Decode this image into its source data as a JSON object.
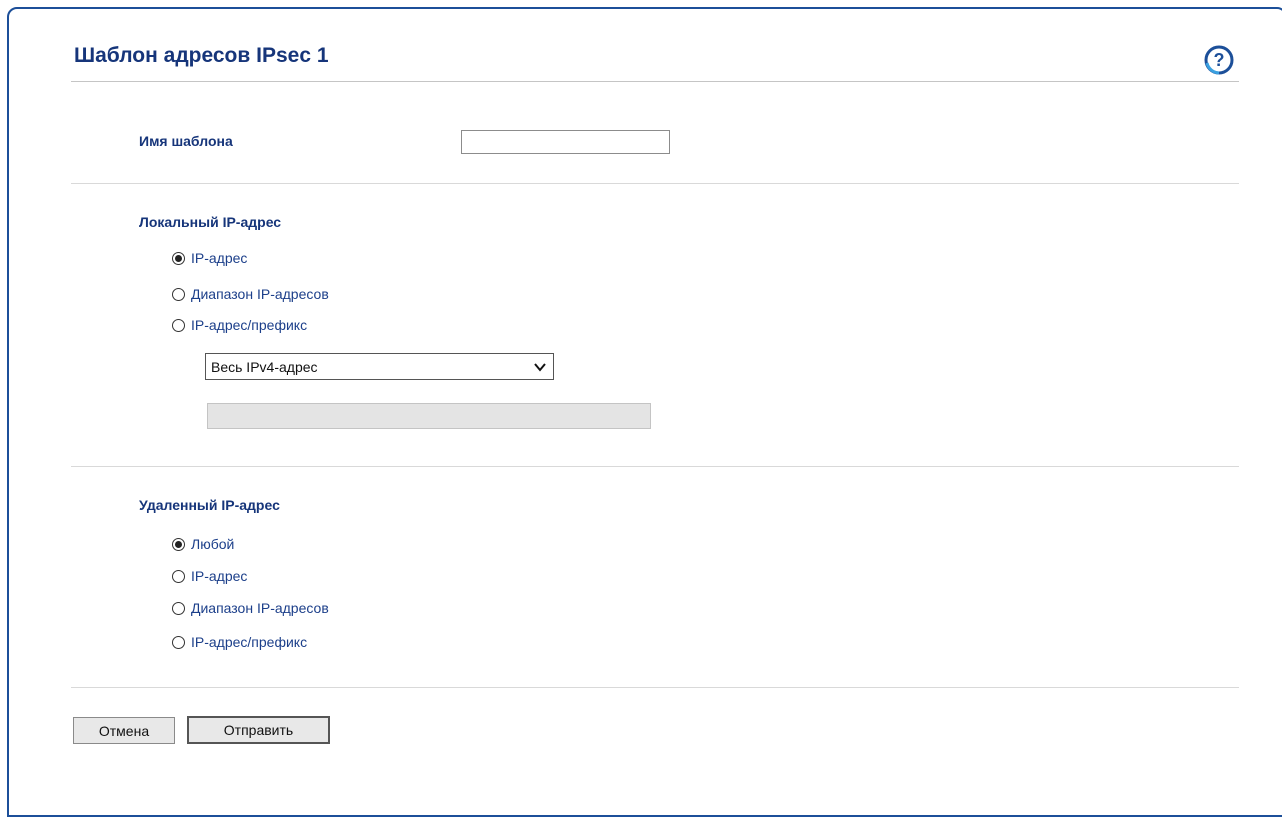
{
  "page": {
    "title": "Шаблон адресов IPsec 1",
    "help_icon": "help-question-icon"
  },
  "template_name": {
    "label": "Имя шаблона",
    "value": ""
  },
  "local_ip": {
    "heading": "Локальный IP-адрес",
    "options": [
      {
        "label": "IP-адрес",
        "checked": true
      },
      {
        "label": "Диапазон IP-адресов",
        "checked": false
      },
      {
        "label": "IP-адрес/префикс",
        "checked": false
      }
    ],
    "select_value": "Весь IPv4-адрес",
    "address_value": ""
  },
  "remote_ip": {
    "heading": "Удаленный IP-адрес",
    "options": [
      {
        "label": "Любой",
        "checked": true
      },
      {
        "label": "IP-адрес",
        "checked": false
      },
      {
        "label": "Диапазон IP-адресов",
        "checked": false
      },
      {
        "label": "IP-адрес/префикс",
        "checked": false
      }
    ]
  },
  "buttons": {
    "cancel": "Отмена",
    "submit": "Отправить"
  },
  "colors": {
    "heading": "#16357a",
    "frame_border": "#1c4f99"
  }
}
